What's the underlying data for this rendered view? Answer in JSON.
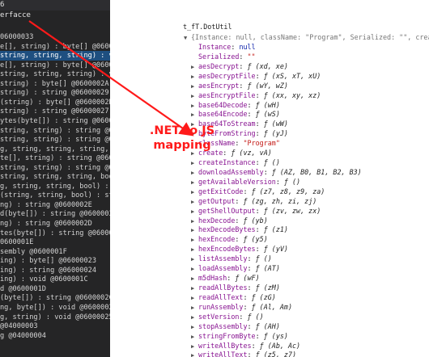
{
  "left_pane": {
    "title_fragment": "6",
    "tab_fragment": "erfacce",
    "rows": [
      {
        "text": "06000033",
        "selected": false
      },
      {
        "text": "e[], string) : byte[] @06000032",
        "selected": false
      },
      {
        "text": "string, string, string) : void @0600003",
        "selected": true
      },
      {
        "text": "e[], string) : byte[] @06000031",
        "selected": false
      },
      {
        "text": "string, string, string) : void @0600003",
        "selected": false
      },
      {
        "text": "string) : byte[] @0600002A",
        "selected": false
      },
      {
        "text": "string) : string @06000029",
        "selected": false
      },
      {
        "text": "(string) : byte[] @0600002B",
        "selected": false
      },
      {
        "text": "string) : string @06000027",
        "selected": false
      },
      {
        "text": "ytes(byte[]) : string @06000028",
        "selected": false
      },
      {
        "text": "string, string) : string @06000038",
        "selected": false
      },
      {
        "text": "string, string) : string @06000036",
        "selected": false
      },
      {
        "text": "g, string, string, string, bool) : object",
        "selected": false
      },
      {
        "text": "te[], string) : string @06000037",
        "selected": false
      },
      {
        "text": "string, string) : string @06000035",
        "selected": false
      },
      {
        "text": "string, string, string, bool) : int @060000",
        "selected": false
      },
      {
        "text": "g, string, string, bool) : string @060000",
        "selected": false
      },
      {
        "text": "(string, string, bool) : string @060000",
        "selected": false
      },
      {
        "text": "ng) : string @0600002E",
        "selected": false
      },
      {
        "text": "d(byte[]) : string @06000030",
        "selected": false
      },
      {
        "text": "ng) : string @0600002D",
        "selected": false
      },
      {
        "text": "tes(byte[]) : string @0600002F",
        "selected": false
      },
      {
        "text": "0600001E",
        "selected": false
      },
      {
        "text": "sembly @0600001F",
        "selected": false
      },
      {
        "text": "ing) : byte[] @06000023",
        "selected": false
      },
      {
        "text": "ing) : string @06000024",
        "selected": false
      },
      {
        "text": "ing) : void @0600001C",
        "selected": false
      },
      {
        "text": "d @0600001D",
        "selected": false
      },
      {
        "text": "(byte[]) : string @0600002C",
        "selected": false
      },
      {
        "text": "ng, byte[]) : void @06000026",
        "selected": false
      },
      {
        "text": "g, string) : void @06000025",
        "selected": false
      },
      {
        "text": "@04000003",
        "selected": false
      },
      {
        "text": "g @04000004",
        "selected": false
      }
    ]
  },
  "annotation": {
    "line1": ".NET to JS",
    "line2": "mapping",
    "color": "#ff1a1a"
  },
  "console": {
    "object_name": "t_fT.DotUtil",
    "summary": "{Instance: null, className: \"Program\", Serialized: \"\", create:",
    "lines": [
      {
        "key": "Instance",
        "sep": ": ",
        "val": "null",
        "kind": "kw",
        "arrow": false,
        "indent": 1
      },
      {
        "key": "Serialized",
        "sep": ": ",
        "val": "\"\"",
        "kind": "str",
        "arrow": false,
        "indent": 1
      },
      {
        "key": "aesDecrypt",
        "sep": ": ",
        "val": "ƒ (xd, xe)",
        "kind": "fn",
        "arrow": true,
        "indent": 0
      },
      {
        "key": "aesDecryptFile",
        "sep": ": ",
        "val": "ƒ (xS, xT, xU)",
        "kind": "fn",
        "arrow": true,
        "indent": 0
      },
      {
        "key": "aesEncrypt",
        "sep": ": ",
        "val": "ƒ (wY, wZ)",
        "kind": "fn",
        "arrow": true,
        "indent": 0
      },
      {
        "key": "aesEncryptFile",
        "sep": ": ",
        "val": "ƒ (xx, xy, xz)",
        "kind": "fn",
        "arrow": true,
        "indent": 0
      },
      {
        "key": "base64Decode",
        "sep": ": ",
        "val": "ƒ (wH)",
        "kind": "fn",
        "arrow": true,
        "indent": 0
      },
      {
        "key": "base64Encode",
        "sep": ": ",
        "val": "ƒ (wS)",
        "kind": "fn",
        "arrow": true,
        "indent": 0
      },
      {
        "key": "base64ToStream",
        "sep": ": ",
        "val": "ƒ (wW)",
        "kind": "fn",
        "arrow": true,
        "indent": 0
      },
      {
        "key": "byteFromString",
        "sep": ": ",
        "val": "ƒ (yJ)",
        "kind": "fn",
        "arrow": true,
        "indent": 0
      },
      {
        "key": "className",
        "sep": ": ",
        "val": "\"Program\"",
        "kind": "str",
        "arrow": false,
        "indent": 1
      },
      {
        "key": "create",
        "sep": ": ",
        "val": "ƒ (vz, vA)",
        "kind": "fn",
        "arrow": true,
        "indent": 0
      },
      {
        "key": "createInstance",
        "sep": ": ",
        "val": "ƒ ()",
        "kind": "fn",
        "arrow": true,
        "indent": 0
      },
      {
        "key": "downloadAssembly",
        "sep": ": ",
        "val": "ƒ (AZ, B0, B1, B2, B3)",
        "kind": "fn",
        "arrow": true,
        "indent": 0
      },
      {
        "key": "getAvailableVersion",
        "sep": ": ",
        "val": "ƒ ()",
        "kind": "fn",
        "arrow": true,
        "indent": 0
      },
      {
        "key": "getExitCode",
        "sep": ": ",
        "val": "ƒ (z7, z8, z9, za)",
        "kind": "fn",
        "arrow": true,
        "indent": 0
      },
      {
        "key": "getOutput",
        "sep": ": ",
        "val": "ƒ (zg, zh, zi, zj)",
        "kind": "fn",
        "arrow": true,
        "indent": 0
      },
      {
        "key": "getShellOutput",
        "sep": ": ",
        "val": "ƒ (zv, zw, zx)",
        "kind": "fn",
        "arrow": true,
        "indent": 0
      },
      {
        "key": "hexDecode",
        "sep": ": ",
        "val": "ƒ (yb)",
        "kind": "fn",
        "arrow": true,
        "indent": 0
      },
      {
        "key": "hexDecodeBytes",
        "sep": ": ",
        "val": "ƒ (z1)",
        "kind": "fn",
        "arrow": true,
        "indent": 0
      },
      {
        "key": "hexEncode",
        "sep": ": ",
        "val": "ƒ (y5)",
        "kind": "fn",
        "arrow": true,
        "indent": 0
      },
      {
        "key": "hexEncodeBytes",
        "sep": ": ",
        "val": "ƒ (yV)",
        "kind": "fn",
        "arrow": true,
        "indent": 0
      },
      {
        "key": "listAssembly",
        "sep": ": ",
        "val": "ƒ ()",
        "kind": "fn",
        "arrow": true,
        "indent": 0
      },
      {
        "key": "loadAssembly",
        "sep": ": ",
        "val": "ƒ (AT)",
        "kind": "fn",
        "arrow": true,
        "indent": 0
      },
      {
        "key": "m5dHash",
        "sep": ": ",
        "val": "ƒ (wF)",
        "kind": "fn",
        "arrow": true,
        "indent": 0
      },
      {
        "key": "readAllBytes",
        "sep": ": ",
        "val": "ƒ (zM)",
        "kind": "fn",
        "arrow": true,
        "indent": 0
      },
      {
        "key": "readAllText",
        "sep": ": ",
        "val": "ƒ (zG)",
        "kind": "fn",
        "arrow": true,
        "indent": 0
      },
      {
        "key": "runAssembly",
        "sep": ": ",
        "val": "ƒ (Al, Am)",
        "kind": "fn",
        "arrow": true,
        "indent": 0
      },
      {
        "key": "setVersion",
        "sep": ": ",
        "val": "ƒ ()",
        "kind": "fn",
        "arrow": true,
        "indent": 0
      },
      {
        "key": "stopAssembly",
        "sep": ": ",
        "val": "ƒ (AH)",
        "kind": "fn",
        "arrow": true,
        "indent": 0
      },
      {
        "key": "stringFromByte",
        "sep": ": ",
        "val": "ƒ (ys)",
        "kind": "fn",
        "arrow": true,
        "indent": 0
      },
      {
        "key": "writeAllBytes",
        "sep": ": ",
        "val": "ƒ (Ab, Ac)",
        "kind": "fn",
        "arrow": true,
        "indent": 0
      },
      {
        "key": "writeAllText",
        "sep": ": ",
        "val": "ƒ (z5, z7)",
        "kind": "fn",
        "arrow": true,
        "indent": 0
      }
    ]
  }
}
